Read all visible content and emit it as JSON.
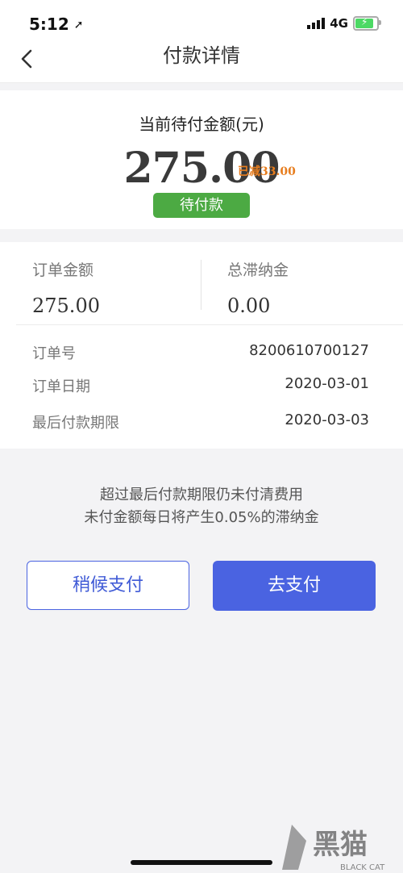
{
  "status_bar": {
    "time": "5:12",
    "network": "4G"
  },
  "nav": {
    "title": "付款详情",
    "back_icon": "chevron-left-icon"
  },
  "amount": {
    "caption": "当前待付金额(元)",
    "value": "275.00",
    "discount": "已减33.00",
    "status": "待付款",
    "status_color": "#4caa43",
    "discount_color": "#e77d1e"
  },
  "summary": {
    "order_amount_label": "订单金额",
    "order_amount_value": "275.00",
    "late_fee_label": "总滞纳金",
    "late_fee_value": "0.00"
  },
  "details": [
    {
      "label": "订单号",
      "value": "8200610700127"
    },
    {
      "label": "订单日期",
      "value": "2020-03-01"
    },
    {
      "label": "最后付款期限",
      "value": "2020-03-03"
    }
  ],
  "notice": {
    "line1": "超过最后付款期限仍未付清费用",
    "line2": "未付金额每日将产生0.05%的滞纳金"
  },
  "actions": {
    "later_label": "稍候支付",
    "pay_label": "去支付",
    "accent_color": "#4a63e1"
  },
  "watermark": {
    "text": "黑猫",
    "sub": "BLACK CAT"
  }
}
